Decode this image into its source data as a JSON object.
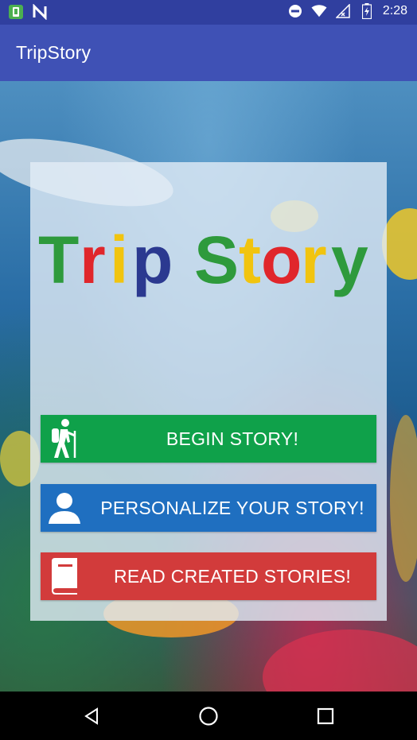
{
  "status_bar": {
    "time": "2:28",
    "left_icons": [
      "app-notification-icon",
      "n-notification-icon"
    ],
    "right_icons": [
      "do-not-disturb-icon",
      "wifi-icon",
      "no-signal-icon",
      "battery-charging-icon"
    ]
  },
  "app_bar": {
    "title": "TripStory"
  },
  "logo": {
    "letters": [
      "T",
      "r",
      "i",
      "p",
      " ",
      "S",
      "t",
      "o",
      "r",
      "y"
    ],
    "colors": [
      "#2e9a3c",
      "#e0262b",
      "#f1c40f",
      "#2b3990",
      "",
      "#2e9a3c",
      "#f1c40f",
      "#e0262b",
      "#f1c40f",
      "#2e9a3c"
    ]
  },
  "buttons": {
    "begin": {
      "label": "BEGIN STORY!",
      "icon": "hiker-icon",
      "color": "#0fa14a"
    },
    "personalize": {
      "label": "PERSONALIZE YOUR STORY!",
      "icon": "person-icon",
      "color": "#1f6fc0"
    },
    "read": {
      "label": "READ CREATED STORIES!",
      "icon": "book-icon",
      "color": "#d23b3b"
    }
  },
  "nav_bar": {
    "buttons": [
      "back-icon",
      "home-icon",
      "recents-icon"
    ]
  }
}
